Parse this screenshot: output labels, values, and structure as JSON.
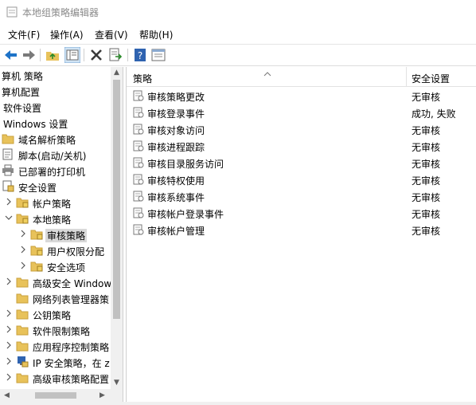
{
  "window": {
    "title": "本地组策略编辑器"
  },
  "menu": {
    "items": [
      "文件(F)",
      "操作(A)",
      "查看(V)",
      "帮助(H)"
    ]
  },
  "toolbar": {
    "icons": [
      "back-arrow-icon",
      "forward-arrow-icon",
      "up-folder-icon",
      "show-hide-tree-icon",
      "delete-icon",
      "export-list-icon",
      "help-icon",
      "properties-icon"
    ]
  },
  "tree": {
    "items": [
      {
        "label": "算机 策略"
      },
      {
        "label": "算机配置"
      },
      {
        "label": "软件设置"
      },
      {
        "label": "Windows 设置"
      },
      {
        "label": "域名解析策略"
      },
      {
        "label": "脚本(启动/关机)"
      },
      {
        "label": "已部署的打印机"
      },
      {
        "label": "安全设置"
      },
      {
        "label": "帐户策略"
      },
      {
        "label": "本地策略"
      },
      {
        "label": "审核策略"
      },
      {
        "label": "用户权限分配"
      },
      {
        "label": "安全选项"
      },
      {
        "label": "高级安全 Window"
      },
      {
        "label": "网络列表管理器策"
      },
      {
        "label": "公钥策略"
      },
      {
        "label": "软件限制策略"
      },
      {
        "label": "应用程序控制策略"
      },
      {
        "label": "IP 安全策略，在 z"
      },
      {
        "label": "高级审核策略配置"
      }
    ]
  },
  "list": {
    "columns": [
      "策略",
      "安全设置"
    ],
    "rows": [
      {
        "name": "审核策略更改",
        "value": "无审核"
      },
      {
        "name": "审核登录事件",
        "value": "成功, 失败"
      },
      {
        "name": "审核对象访问",
        "value": "无审核"
      },
      {
        "name": "审核进程跟踪",
        "value": "无审核"
      },
      {
        "name": "审核目录服务访问",
        "value": "无审核"
      },
      {
        "name": "审核特权使用",
        "value": "无审核"
      },
      {
        "name": "审核系统事件",
        "value": "无审核"
      },
      {
        "name": "审核帐户登录事件",
        "value": "无审核"
      },
      {
        "name": "审核帐户管理",
        "value": "无审核"
      }
    ]
  }
}
